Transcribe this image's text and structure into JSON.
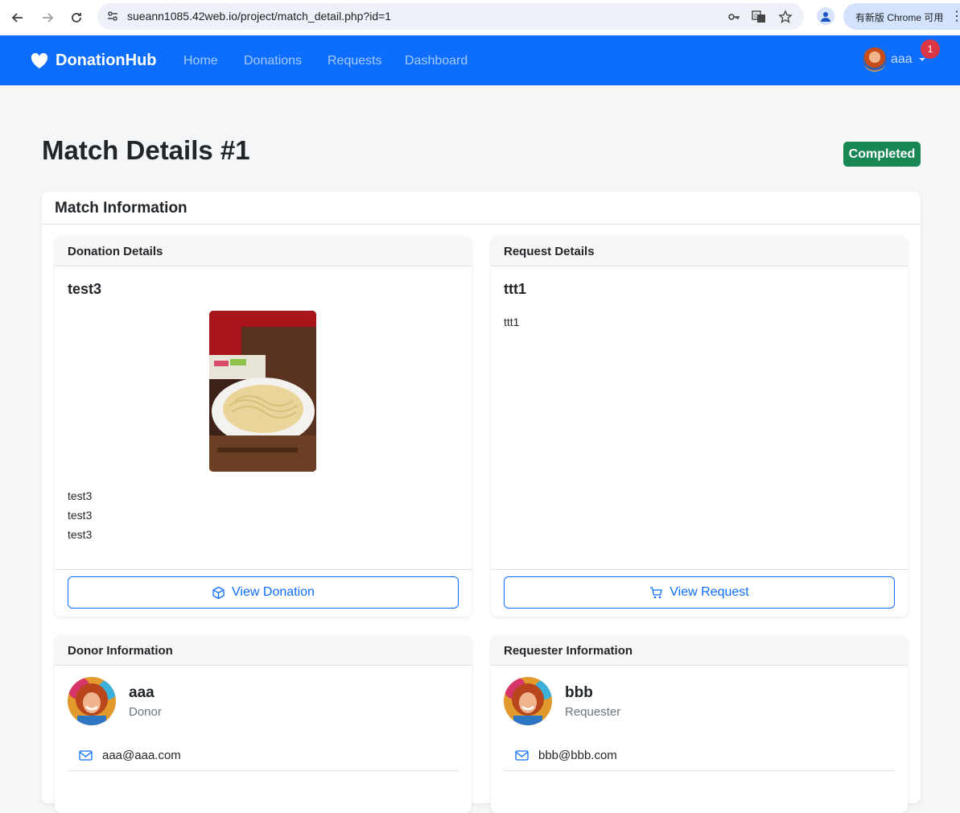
{
  "browser": {
    "url": "sueann1085.42web.io/project/match_detail.php?id=1",
    "update_label": "有新版 Chrome 可用"
  },
  "navbar": {
    "brand": "DonationHub",
    "links": [
      "Home",
      "Donations",
      "Requests",
      "Dashboard"
    ],
    "user_name": "aaa",
    "notification_count": "1",
    "color": "#0d6efd"
  },
  "page": {
    "title": "Match Details #1",
    "status": "Completed",
    "status_color": "#198754"
  },
  "match_info": {
    "header": "Match Information",
    "donation": {
      "header": "Donation Details",
      "title": "test3",
      "image": "noodle-bowl-photo",
      "lines": [
        "test3",
        "test3",
        "test3"
      ],
      "button": "View Donation"
    },
    "request": {
      "header": "Request Details",
      "title": "ttt1",
      "lines": [
        "ttt1"
      ],
      "button": "View Request"
    },
    "donor": {
      "header": "Donor Information",
      "name": "aaa",
      "role": "Donor",
      "email": "aaa@aaa.com"
    },
    "requester": {
      "header": "Requester Information",
      "name": "bbb",
      "role": "Requester",
      "email": "bbb@bbb.com"
    }
  }
}
